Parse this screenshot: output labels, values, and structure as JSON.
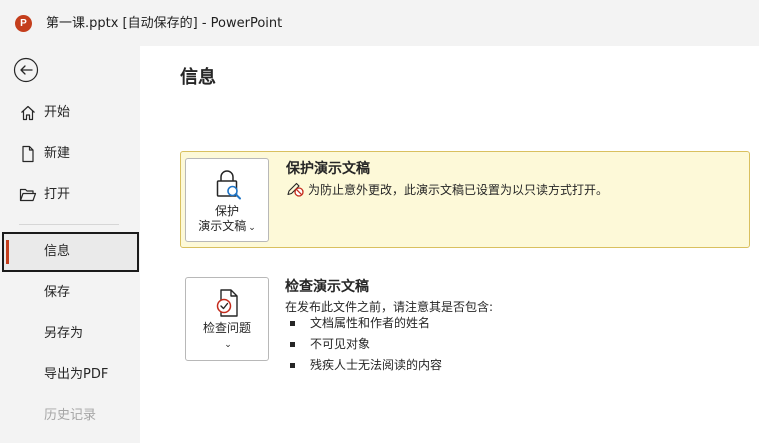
{
  "titlebar": {
    "app_icon_letter": "P",
    "title": "第一课.pptx [自动保存的]  -  PowerPoint"
  },
  "sidebar": {
    "items": [
      {
        "label": "开始",
        "icon": "home-icon"
      },
      {
        "label": "新建",
        "icon": "new-document-icon"
      },
      {
        "label": "打开",
        "icon": "open-folder-icon"
      },
      {
        "label": "信息",
        "selected": true
      },
      {
        "label": "保存"
      },
      {
        "label": "另存为"
      },
      {
        "label": "导出为PDF"
      },
      {
        "label": "历史记录",
        "disabled": true
      }
    ]
  },
  "main": {
    "title": "信息",
    "protect": {
      "button_line1": "保护",
      "button_line2": "演示文稿",
      "heading": "保护演示文稿",
      "description": "为防止意外更改，此演示文稿已设置为以只读方式打开。"
    },
    "inspect": {
      "button_label": "检查问题",
      "heading": "检查演示文稿",
      "description": "在发布此文件之前，请注意其是否包含:",
      "bullets": [
        "文档属性和作者的姓名",
        "不可见对象",
        "残疾人士无法阅读的内容"
      ]
    }
  },
  "colors": {
    "accent": "#c43e1c",
    "panel_highlight": "#fdf9d8",
    "panel_border": "#d9c05f"
  }
}
